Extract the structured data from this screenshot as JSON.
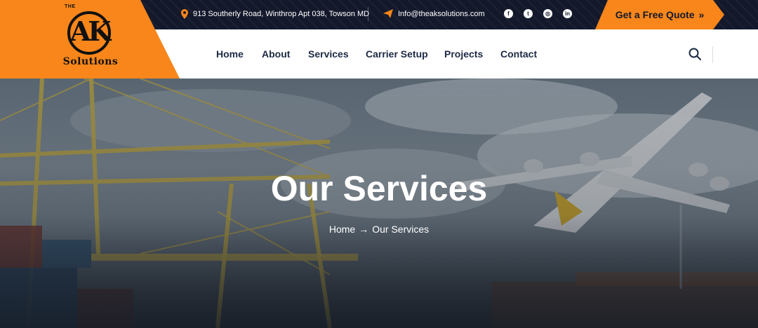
{
  "brand": {
    "top_text": "THE",
    "letters": "AK",
    "name": "Solutions"
  },
  "contact": {
    "address": "913 Southerly Road, Winthrop Apt 038, Towson MD",
    "email": "Info@theaksolutions.com"
  },
  "socials": [
    {
      "icon": "facebook-icon",
      "glyph": "f"
    },
    {
      "icon": "twitter-icon",
      "glyph": "t"
    },
    {
      "icon": "instagram-icon",
      "glyph": "◎"
    },
    {
      "icon": "linkedin-icon",
      "glyph": "in"
    }
  ],
  "quote_button": {
    "label": "Get a Free Quote",
    "chevron": "»"
  },
  "nav": {
    "items": [
      {
        "label": "Home"
      },
      {
        "label": "About"
      },
      {
        "label": "Services"
      },
      {
        "label": "Carrier Setup"
      },
      {
        "label": "Projects"
      },
      {
        "label": "Contact"
      }
    ]
  },
  "hero": {
    "title": "Our Services",
    "breadcrumb": {
      "home": "Home",
      "arrow": "→",
      "current": "Our Services"
    }
  },
  "colors": {
    "accent": "#f8861a",
    "dark": "#13182b",
    "nav_text": "#1d2a44"
  }
}
